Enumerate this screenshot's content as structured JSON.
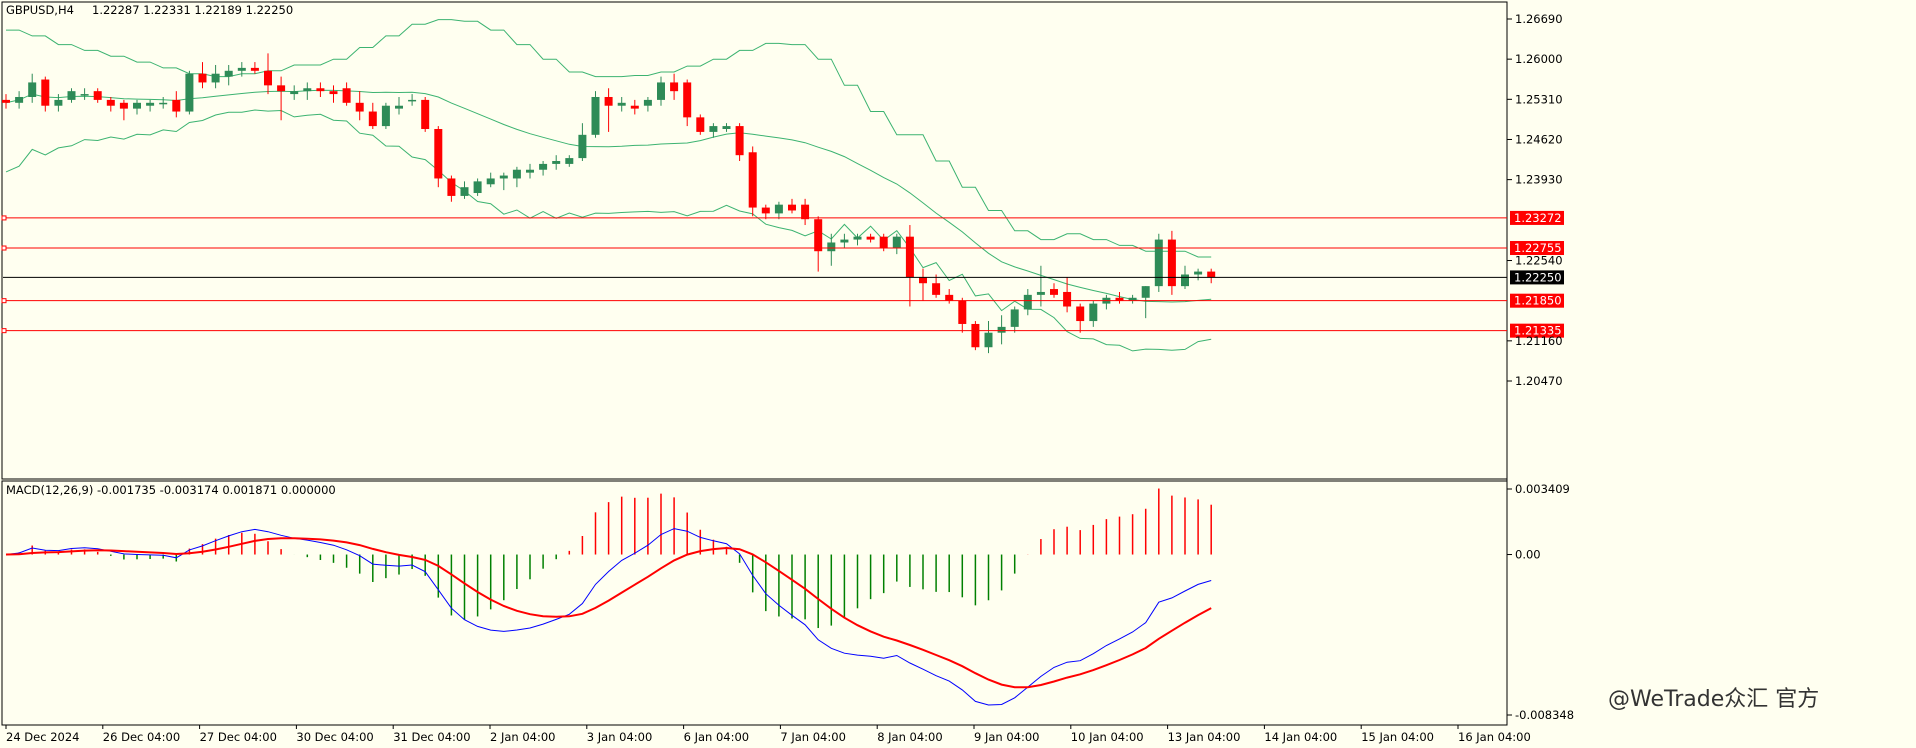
{
  "header": {
    "symbol": "GBPUSD,H4",
    "ohlc": "1.22287 1.22331 1.22189 1.22250",
    "macd_label": "MACD(12,26,9) -0.001735 -0.003174 0.001871 0.000000"
  },
  "price_axis": {
    "ticks": [
      "1.26690",
      "1.26000",
      "1.25310",
      "1.24620",
      "1.23930",
      "1.22540",
      "1.21160",
      "1.20470"
    ],
    "current_price": "1.22250",
    "levels": [
      "1.23272",
      "1.22755",
      "1.21850",
      "1.21335"
    ]
  },
  "macd_axis": {
    "top": "0.003409",
    "zero": "0.00",
    "bottom": "-0.008348"
  },
  "time_axis": [
    "24 Dec 2024",
    "26 Dec 04:00",
    "27 Dec 04:00",
    "30 Dec 04:00",
    "31 Dec 04:00",
    "2 Jan 04:00",
    "3 Jan 04:00",
    "6 Jan 04:00",
    "7 Jan 04:00",
    "8 Jan 04:00",
    "9 Jan 04:00",
    "10 Jan 04:00",
    "13 Jan 04:00",
    "14 Jan 04:00",
    "15 Jan 04:00",
    "16 Jan 04:00"
  ],
  "watermark": "@WeTrade众汇 官方",
  "colors": {
    "bull": "#2E8B57",
    "bear": "#FF0000",
    "bands": "#3CB371",
    "macd_line": "#0000FF",
    "signal_line": "#FF0000",
    "level": "#FF0000"
  },
  "chart_data": {
    "type": "candlestick",
    "series": [
      {
        "name": "GBPUSD,H4",
        "ohlc": [
          [
            1.253,
            1.254,
            1.2515,
            1.2525
          ],
          [
            1.2525,
            1.2545,
            1.2515,
            1.2535
          ],
          [
            1.2535,
            1.2575,
            1.2525,
            1.256
          ],
          [
            1.2565,
            1.257,
            1.251,
            1.252
          ],
          [
            1.252,
            1.254,
            1.251,
            1.253
          ],
          [
            1.253,
            1.255,
            1.2525,
            1.2545
          ],
          [
            1.254,
            1.255,
            1.253,
            1.254
          ],
          [
            1.2545,
            1.255,
            1.2525,
            1.253
          ],
          [
            1.253,
            1.2535,
            1.251,
            1.252
          ],
          [
            1.2525,
            1.253,
            1.2495,
            1.2515
          ],
          [
            1.2515,
            1.253,
            1.2505,
            1.2525
          ],
          [
            1.252,
            1.253,
            1.251,
            1.2525
          ],
          [
            1.2525,
            1.2535,
            1.2515,
            1.2525
          ],
          [
            1.253,
            1.2545,
            1.25,
            1.251
          ],
          [
            1.251,
            1.258,
            1.2505,
            1.2575
          ],
          [
            1.2575,
            1.2595,
            1.255,
            1.256
          ],
          [
            1.256,
            1.259,
            1.255,
            1.2575
          ],
          [
            1.257,
            1.259,
            1.2555,
            1.258
          ],
          [
            1.258,
            1.2595,
            1.257,
            1.2585
          ],
          [
            1.2585,
            1.2595,
            1.2575,
            1.258
          ],
          [
            1.258,
            1.261,
            1.254,
            1.2555
          ],
          [
            1.2555,
            1.257,
            1.2495,
            1.2545
          ],
          [
            1.254,
            1.2555,
            1.253,
            1.2545
          ],
          [
            1.2545,
            1.256,
            1.253,
            1.255
          ],
          [
            1.255,
            1.256,
            1.2535,
            1.2545
          ],
          [
            1.2545,
            1.2555,
            1.2525,
            1.254
          ],
          [
            1.255,
            1.256,
            1.252,
            1.2525
          ],
          [
            1.2525,
            1.2545,
            1.2495,
            1.251
          ],
          [
            1.251,
            1.2525,
            1.248,
            1.2485
          ],
          [
            1.2485,
            1.2525,
            1.248,
            1.252
          ],
          [
            1.2515,
            1.2535,
            1.2505,
            1.252
          ],
          [
            1.253,
            1.254,
            1.252,
            1.253
          ],
          [
            1.253,
            1.2535,
            1.2475,
            1.248
          ],
          [
            1.248,
            1.2485,
            1.238,
            1.2395
          ],
          [
            1.2395,
            1.24,
            1.2355,
            1.2365
          ],
          [
            1.2365,
            1.239,
            1.236,
            1.238
          ],
          [
            1.237,
            1.2395,
            1.2365,
            1.239
          ],
          [
            1.2385,
            1.2405,
            1.238,
            1.2395
          ],
          [
            1.2395,
            1.2405,
            1.2375,
            1.24
          ],
          [
            1.2395,
            1.2415,
            1.238,
            1.241
          ],
          [
            1.2405,
            1.242,
            1.2395,
            1.241
          ],
          [
            1.241,
            1.2425,
            1.24,
            1.242
          ],
          [
            1.242,
            1.2435,
            1.241,
            1.2425
          ],
          [
            1.242,
            1.2435,
            1.2415,
            1.243
          ],
          [
            1.243,
            1.249,
            1.2425,
            1.247
          ],
          [
            1.247,
            1.2545,
            1.2465,
            1.2535
          ],
          [
            1.2535,
            1.255,
            1.2475,
            1.252
          ],
          [
            1.252,
            1.2535,
            1.251,
            1.2525
          ],
          [
            1.252,
            1.253,
            1.2505,
            1.2515
          ],
          [
            1.252,
            1.2535,
            1.251,
            1.253
          ],
          [
            1.253,
            1.257,
            1.252,
            1.256
          ],
          [
            1.256,
            1.2575,
            1.253,
            1.2545
          ],
          [
            1.256,
            1.2565,
            1.2485,
            1.25
          ],
          [
            1.25,
            1.2505,
            1.247,
            1.2475
          ],
          [
            1.2475,
            1.249,
            1.2465,
            1.2485
          ],
          [
            1.248,
            1.249,
            1.2475,
            1.2485
          ],
          [
            1.2485,
            1.249,
            1.2425,
            1.2435
          ],
          [
            1.244,
            1.245,
            1.233,
            1.2345
          ],
          [
            1.2345,
            1.235,
            1.2325,
            1.2335
          ],
          [
            1.2335,
            1.2355,
            1.2325,
            1.235
          ],
          [
            1.235,
            1.236,
            1.2335,
            1.234
          ],
          [
            1.235,
            1.236,
            1.2315,
            1.2325
          ],
          [
            1.2325,
            1.233,
            1.2235,
            1.227
          ],
          [
            1.227,
            1.23,
            1.2245,
            1.2285
          ],
          [
            1.2285,
            1.23,
            1.2275,
            1.229
          ],
          [
            1.229,
            1.23,
            1.228,
            1.2295
          ],
          [
            1.2295,
            1.23,
            1.2285,
            1.229
          ],
          [
            1.2295,
            1.23,
            1.227,
            1.2275
          ],
          [
            1.2275,
            1.23,
            1.2265,
            1.2295
          ],
          [
            1.2295,
            1.2315,
            1.2175,
            1.2225
          ],
          [
            1.2225,
            1.224,
            1.2185,
            1.2215
          ],
          [
            1.2215,
            1.223,
            1.219,
            1.2195
          ],
          [
            1.2195,
            1.2205,
            1.218,
            1.2185
          ],
          [
            1.2185,
            1.219,
            1.213,
            1.2145
          ],
          [
            1.2145,
            1.215,
            1.21,
            1.2105
          ],
          [
            1.2105,
            1.215,
            1.2095,
            1.213
          ],
          [
            1.213,
            1.216,
            1.211,
            1.214
          ],
          [
            1.214,
            1.2175,
            1.213,
            1.217
          ],
          [
            1.217,
            1.2205,
            1.216,
            1.2195
          ],
          [
            1.2195,
            1.2245,
            1.2175,
            1.22
          ],
          [
            1.2205,
            1.2215,
            1.219,
            1.2195
          ],
          [
            1.22,
            1.2225,
            1.2165,
            1.2175
          ],
          [
            1.2175,
            1.218,
            1.213,
            1.215
          ],
          [
            1.215,
            1.2185,
            1.214,
            1.218
          ],
          [
            1.218,
            1.2195,
            1.217,
            1.219
          ],
          [
            1.219,
            1.22,
            1.218,
            1.2185
          ],
          [
            1.2185,
            1.2195,
            1.218,
            1.219
          ],
          [
            1.219,
            1.221,
            1.2155,
            1.221
          ],
          [
            1.221,
            1.23,
            1.22,
            1.229
          ],
          [
            1.229,
            1.2305,
            1.2195,
            1.221
          ],
          [
            1.221,
            1.2245,
            1.2205,
            1.223
          ],
          [
            1.223,
            1.224,
            1.222,
            1.2235
          ],
          [
            1.2235,
            1.224,
            1.2215,
            1.2225
          ]
        ]
      }
    ],
    "bands": {
      "name": "Bollinger Bands",
      "upper": [
        1.265,
        1.264,
        1.2625,
        1.2615,
        1.2605,
        1.2595,
        1.2585,
        1.2575,
        1.257,
        1.2575,
        1.258,
        1.259,
        1.26,
        1.262,
        1.264,
        1.266,
        1.2668,
        1.2665,
        1.265,
        1.2625,
        1.26,
        1.2578,
        1.257,
        1.2572,
        1.2578,
        1.2588,
        1.26,
        1.2615,
        1.2627,
        1.2625,
        1.26,
        1.2555,
        1.251,
        1.247,
        1.2425,
        1.238,
        1.234,
        1.2305,
        1.229,
        1.23,
        1.229,
        1.228,
        1.227,
        1.227,
        1.226
      ]
    },
    "macd": {
      "name": "MACD(12,26,9)",
      "ylim": [
        -0.008348,
        0.003409
      ]
    }
  }
}
